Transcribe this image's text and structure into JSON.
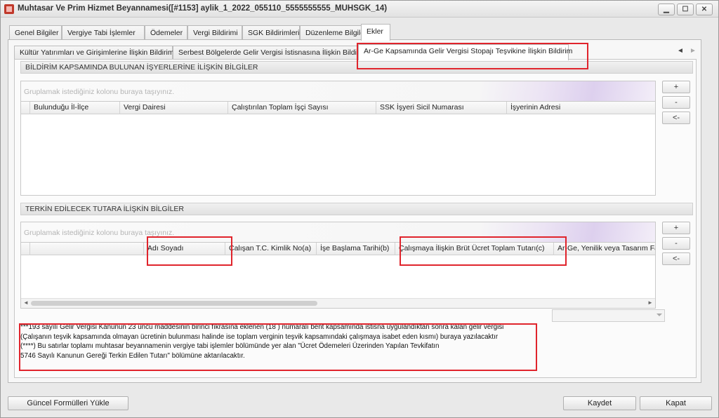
{
  "window": {
    "title": "Muhtasar Ve Prim Hizmet Beyannamesi([#1153] aylik_1_2022_055110_5555555555_MUHSGK_14)",
    "controls": {
      "minimize": "▁",
      "maximize": "☐",
      "close": "✕"
    }
  },
  "main_tabs": [
    {
      "label": "Genel Bilgiler"
    },
    {
      "label": "Vergiye Tabi İşlemler"
    },
    {
      "label": "Ödemeler"
    },
    {
      "label": "Vergi Bildirimi"
    },
    {
      "label": "SGK Bildirimleri"
    },
    {
      "label": "Düzenleme Bilgileri"
    },
    {
      "label": "Ekler",
      "active": true
    }
  ],
  "sub_tabs": [
    {
      "label": "Kültür Yatırımları ve Girişimlerine İlişkin Bildirim"
    },
    {
      "label": "Serbest Bölgelerde Gelir Vergisi İstisnasına İlişkin Bildirim"
    },
    {
      "label": "Ar-Ge Kapsamında Gelir Vergisi Stopajı Teşvikine İlişkin Bildirim",
      "active": true
    }
  ],
  "tab_scroll": {
    "left": "◄",
    "right": "►"
  },
  "section1": {
    "title": "BİLDİRİM KAPSAMINDA BULUNAN İŞYERLERİNE İLİŞKİN BİLGİLER",
    "group_placeholder": "Gruplamak istediğiniz kolonu buraya taşıyınız.",
    "columns": [
      "Bulunduğu İl-İlçe",
      "Vergi Dairesi",
      "Çalıştırılan Toplam İşçi Sayısı",
      "SSK İşyeri Sicil Numarası",
      "İşyerinin Adresi"
    ],
    "buttons": {
      "add": "+",
      "remove": "-",
      "back": "<-"
    }
  },
  "section2": {
    "title": "TERKİN EDİLECEK TUTARA İLİŞKİN BİLGİLER",
    "group_placeholder": "Gruplamak istediğiniz kolonu buraya taşıyınız.",
    "columns": [
      "Adı Soyadı",
      "Çalışan T.C. Kimlik No(a)",
      "İşe Başlama Tarihi(b)",
      "Çalışmaya İlişkin Brüt Ücret Toplam Tutarı(c)",
      "Ar-Ge, Yenilik veya Tasarım Faaliyeti"
    ],
    "buttons": {
      "add": "+",
      "remove": "-",
      "back": "<-"
    },
    "scroll": {
      "left": "◄",
      "right": "►"
    }
  },
  "notes": [
    "***193 sayılı Gelir Vergisi Kanunun 23 üncü maddesinin birinci fıkrasına eklenen (18 ) numaralı bent kapsamında istisna uygulandıktan sonra kalan gelir vergisi",
    "(Çalışanın teşvik kapsamında olmayan ücretinin bulunması halinde ise toplam verginin teşvik kapsamındaki çalışmaya isabet eden kısmı) buraya yazılacaktır",
    "(****) Bu satırlar toplamı muhtasar beyannamenin vergiye tabi işlemler bölümünde yer alan \"Ücret Ödemeleri Üzerinden Yapılan Tevkifatın",
    "5746 Sayılı Kanunun Gereği Terkin Edilen Tutarı\" bölümüne aktarılacaktır."
  ],
  "footer": {
    "load_formulas": "Güncel Formülleri Yükle",
    "save": "Kaydet",
    "close": "Kapat"
  },
  "colors": {
    "highlight": "#e0242c"
  }
}
